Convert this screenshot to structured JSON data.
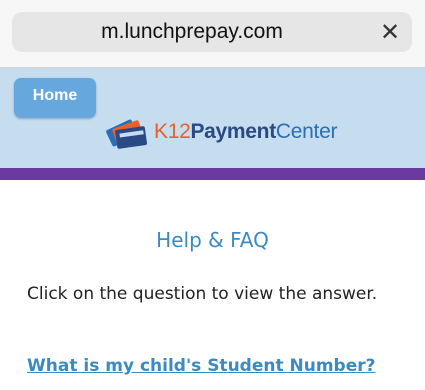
{
  "browser": {
    "url": "m.lunchprepay.com",
    "close_glyph": "✕"
  },
  "header": {
    "home_label": "Home",
    "logo": {
      "part1": "K12",
      "part2": "Payment",
      "part3": "Center"
    }
  },
  "main": {
    "title": "Help & FAQ",
    "intro": "Click on the question to view the answer.",
    "questions": [
      "What is my child's Student Number?"
    ]
  },
  "colors": {
    "header_bg": "#c5ddef",
    "home_button": "#66a8dd",
    "accent_bar": "#6a3aa0",
    "link": "#3a8bc4"
  }
}
